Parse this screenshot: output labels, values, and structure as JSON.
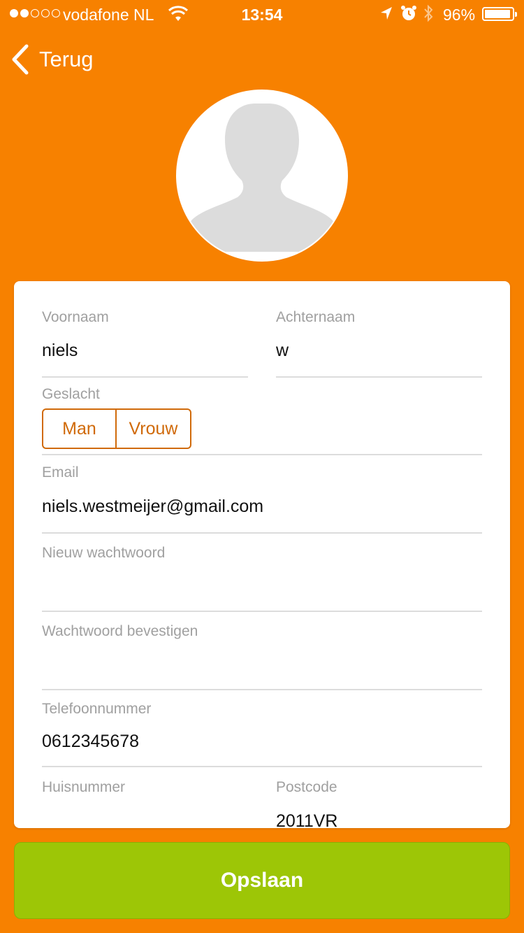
{
  "status_bar": {
    "carrier": "vodafone NL",
    "time": "13:54",
    "battery": "96%",
    "signal_bars": 2,
    "icons": [
      "wifi-icon",
      "location-arrow-icon",
      "alarm-icon",
      "bluetooth-icon",
      "battery-icon"
    ]
  },
  "nav": {
    "back_label": "Terug"
  },
  "profile": {
    "avatar": "avatar-placeholder-icon"
  },
  "form": {
    "first_name": {
      "label": "Voornaam",
      "value": "niels"
    },
    "last_name": {
      "label": "Achternaam",
      "value": "w"
    },
    "gender": {
      "label": "Geslacht",
      "options": [
        "Man",
        "Vrouw"
      ]
    },
    "email": {
      "label": "Email",
      "value": "niels.westmeijer@gmail.com"
    },
    "new_password": {
      "label": "Nieuw wachtwoord",
      "value": ""
    },
    "confirm_password": {
      "label": "Wachtwoord bevestigen",
      "value": ""
    },
    "phone": {
      "label": "Telefoonnummer",
      "value": "0612345678"
    },
    "house_number": {
      "label": "Huisnummer",
      "value": ""
    },
    "postcode": {
      "label": "Postcode",
      "value": "2011VR"
    }
  },
  "actions": {
    "save_label": "Opslaan"
  },
  "colors": {
    "background": "#F78100",
    "accent": "#D06A0A",
    "save": "#9DC606"
  }
}
